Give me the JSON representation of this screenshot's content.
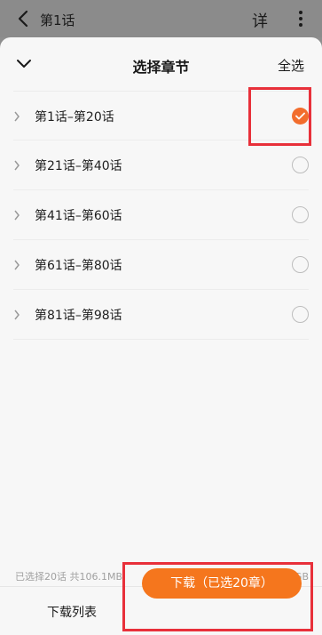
{
  "topbar": {
    "title": "第1话",
    "detail_label": "详",
    "icons": {
      "back": "chevron-left-icon",
      "more": "more-vertical-icon"
    }
  },
  "sheet": {
    "title": "选择章节",
    "select_all_label": "全选",
    "collapse_icon": "chevron-down-icon"
  },
  "chapters": [
    {
      "label": "第1话–第20话",
      "selected": true
    },
    {
      "label": "第21话–第40话",
      "selected": false
    },
    {
      "label": "第41话–第60话",
      "selected": false
    },
    {
      "label": "第61话–第80话",
      "selected": false
    },
    {
      "label": "第81话–第98话",
      "selected": false
    }
  ],
  "footer": {
    "selected_info": "已选择20话 共106.1MB",
    "remaining_info": "剩余1.9GB",
    "download_list_label": "下载列表",
    "download_button_label": "下载（已选20章）"
  },
  "colors": {
    "accent": "#f5761d",
    "check": "#f26d2d",
    "annotation": "#e8303a"
  }
}
